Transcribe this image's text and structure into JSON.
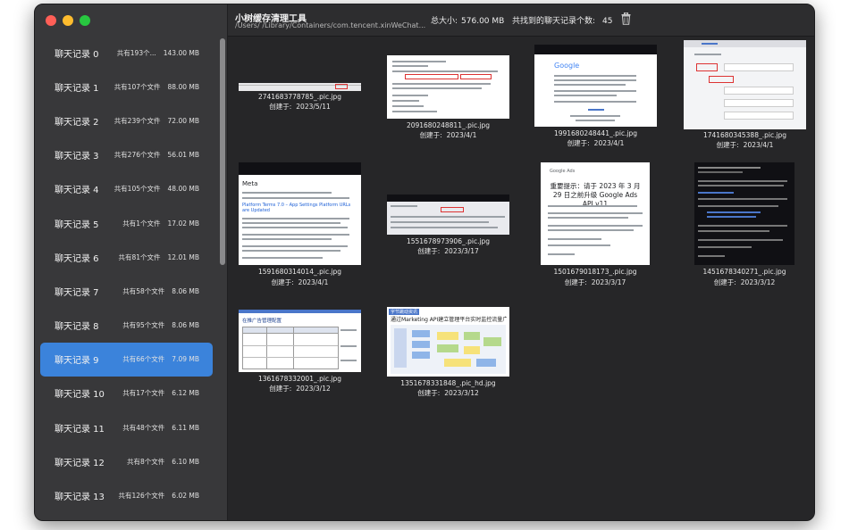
{
  "app_title": "小树缓存清理工具",
  "path": "/Users/            /Library/Containers/com.tencent.xinWeChat...",
  "total_label": "总大小:",
  "total_value": "576.00 MB",
  "found_label": "共找到的聊天记录个数:",
  "found_value": "45",
  "sidebar": {
    "items": [
      {
        "title": "聊天记录 0",
        "count": "共有193个...",
        "size": "143.00 MB"
      },
      {
        "title": "聊天记录 1",
        "count": "共有107个文件",
        "size": "88.00 MB"
      },
      {
        "title": "聊天记录 2",
        "count": "共有239个文件",
        "size": "72.00 MB"
      },
      {
        "title": "聊天记录 3",
        "count": "共有276个文件",
        "size": "56.01 MB"
      },
      {
        "title": "聊天记录 4",
        "count": "共有105个文件",
        "size": "48.00 MB"
      },
      {
        "title": "聊天记录 5",
        "count": "共有1个文件",
        "size": "17.02 MB"
      },
      {
        "title": "聊天记录 6",
        "count": "共有81个文件",
        "size": "12.01 MB"
      },
      {
        "title": "聊天记录 7",
        "count": "共有58个文件",
        "size": "8.06 MB"
      },
      {
        "title": "聊天记录 8",
        "count": "共有95个文件",
        "size": "8.06 MB"
      },
      {
        "title": "聊天记录 9",
        "count": "共有66个文件",
        "size": "7.09 MB"
      },
      {
        "title": "聊天记录 10",
        "count": "共有17个文件",
        "size": "6.12 MB"
      },
      {
        "title": "聊天记录 11",
        "count": "共有48个文件",
        "size": "6.11 MB"
      },
      {
        "title": "聊天记录 12",
        "count": "共有8个文件",
        "size": "6.10 MB"
      },
      {
        "title": "聊天记录 13",
        "count": "共有126个文件",
        "size": "6.02 MB"
      }
    ],
    "selected_index": 9
  },
  "files": [
    {
      "name": "2741683778785_.pic.jpg",
      "created_label": "创建于:",
      "date": "2023/5/11"
    },
    {
      "name": "2091680248811_.pic.jpg",
      "created_label": "创建于:",
      "date": "2023/4/1"
    },
    {
      "name": "1991680248441_.pic.jpg",
      "created_label": "创建于:",
      "date": "2023/4/1"
    },
    {
      "name": "1741680345388_.pic.jpg",
      "created_label": "创建于:",
      "date": "2023/4/1"
    },
    {
      "name": "1591680314014_.pic.jpg",
      "created_label": "创建于:",
      "date": "2023/4/1"
    },
    {
      "name": "1551678973906_.pic.jpg",
      "created_label": "创建于:",
      "date": "2023/3/17"
    },
    {
      "name": "1501679018173_.pic.jpg",
      "created_label": "创建于:",
      "date": "2023/3/17"
    },
    {
      "name": "1451678340271_.pic.jpg",
      "created_label": "创建于:",
      "date": "2023/3/12"
    },
    {
      "name": "1361678332001_.pic.jpg",
      "created_label": "创建于:",
      "date": "2023/3/12"
    },
    {
      "name": "1351678331848_.pic_hd.jpg",
      "created_label": "创建于:",
      "date": "2023/3/12"
    }
  ],
  "thumbnails": {
    "google_logo": "Google",
    "meta_logo": "Meta",
    "meta_heading": "Platform Terms 7.0 – App Settings Platform URLs are Updated",
    "google_ads_logo": "Google Ads",
    "google_ads_notice": "重要提示：请于 2023 年 3 月 29 日之前升级 Google Ads API v11",
    "marketing_tag": "字节跳动资讯",
    "marketing_title": "通过Marketing API建立管理平台实时监控流量广告",
    "table_title": "在推广告管理配置"
  },
  "colors": {
    "accent": "#3b83db",
    "window_bg": "#2d2d2f",
    "sidebar_bg": "#38383a"
  }
}
